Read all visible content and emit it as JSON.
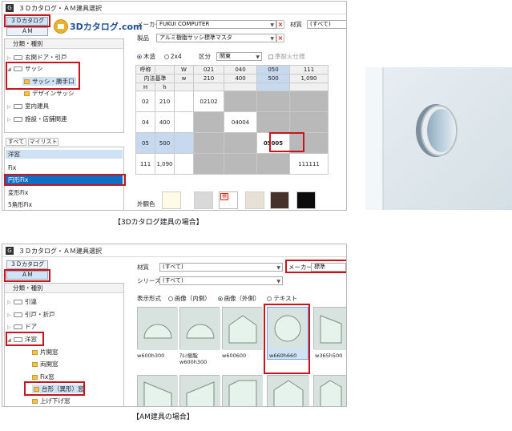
{
  "panel_3d": {
    "window_title": "３Ｄカタログ・ＡＭ建具選択",
    "app_icon": "G",
    "tab_3d": "３Ｄカタログ",
    "tab_am": "ＡＭ",
    "logo_text": "3Dカタログ.com",
    "category_header": "分類・種別",
    "tree": [
      "玄関ドア・引戸",
      "サッシ",
      "サッシ・勝手口",
      "デザインサッシ",
      "室内建具",
      "施設・店舗関連"
    ],
    "maker_label": "メーカー",
    "maker_value": "FUKUI COMPUTER",
    "material_label": "材質",
    "material_value": "(すべて)",
    "product_label": "製品",
    "product_value": "アルミ樹脂サッシ標準マスタ",
    "radio_wood": "木造",
    "radio_2x4": "2x4",
    "region_label": "区分",
    "region_value": "関東",
    "fire_label": "準耐火仕様",
    "grid": {
      "corner_top": "呼称",
      "corner_mid": "内法基準",
      "w_label": "W",
      "w2_label": "w",
      "h_big": "H",
      "h_small": "h",
      "col_codes": [
        "021",
        "040",
        "050",
        "111"
      ],
      "col_sizes": [
        "210",
        "400",
        "500",
        "1,090"
      ],
      "rows": [
        {
          "code": "02",
          "size": "210",
          "cells": [
            "02102",
            "",
            "",
            ""
          ]
        },
        {
          "code": "04",
          "size": "400",
          "cells": [
            "",
            "04004",
            "",
            ""
          ]
        },
        {
          "code": "05",
          "size": "500",
          "cells": [
            "",
            "",
            "05005",
            ""
          ]
        },
        {
          "code": "111",
          "size": "1,090",
          "cells": [
            "",
            "",
            "",
            "111111"
          ]
        }
      ]
    },
    "list_tabs": [
      "すべて",
      "マイリスト"
    ],
    "list_items": [
      "洋窓",
      "Fix",
      "円形Fix",
      "変形Fix",
      "5角形Fix"
    ],
    "exterior_label": "外観色",
    "swatches": [
      "#fdfbe8",
      "#d9d9d9",
      "#ffffff",
      "#e6e1d4",
      "#47312b",
      "#0c0c0c"
    ],
    "swatch_mark": "標",
    "caption": "【3Dカタログ建具の場合】"
  },
  "panel_am": {
    "window_title": "３Ｄカタログ・ＡＭ建具選択",
    "app_icon": "G",
    "tab_3d": "３Ｄカタログ",
    "tab_am": "ＡＭ",
    "category_header": "分類・種別",
    "tree": [
      "引違",
      "引戸・折戸",
      "ドア",
      "洋窓",
      "片開窓",
      "両開窓",
      "Fix窓",
      "台形（異形）窓",
      "上げ下げ窓"
    ],
    "material_label": "材質",
    "material_value": "(すべて)",
    "maker_label": "メーカー",
    "maker_value": "標準",
    "series_label": "シリーズ",
    "series_value": "(すべて)",
    "display_label": "表示形式",
    "display_options": [
      "画像（内側）",
      "画像（外側）",
      "テキスト"
    ],
    "thumbs": [
      "w600h300",
      "ｱﾙﾐ樹脂 w600h300",
      "w600600",
      "w660h660",
      "w365h500"
    ],
    "caption": "【AM建具の場合】"
  }
}
